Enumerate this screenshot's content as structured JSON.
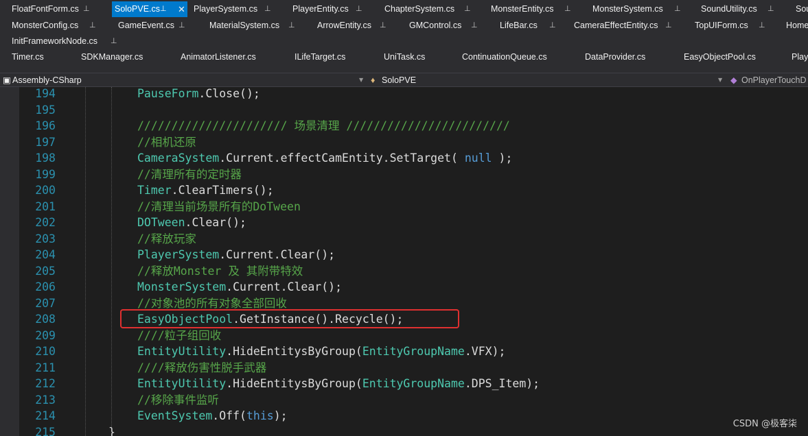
{
  "tabs": {
    "row1": [
      {
        "label": "FloatFontForm.cs"
      },
      {
        "label": "SoloPVE.cs",
        "active": true
      },
      {
        "label": "PlayerSystem.cs"
      },
      {
        "label": "PlayerEntity.cs"
      },
      {
        "label": "ChapterSystem.cs"
      },
      {
        "label": "MonsterEntity.cs"
      },
      {
        "label": "MonsterSystem.cs"
      },
      {
        "label": "SoundUtility.cs"
      },
      {
        "label": "Sou"
      }
    ],
    "row2": [
      {
        "label": "MonsterConfig.cs"
      },
      {
        "label": "GameEvent.cs"
      },
      {
        "label": "MaterialSystem.cs"
      },
      {
        "label": "ArrowEntity.cs"
      },
      {
        "label": "GMControl.cs"
      },
      {
        "label": "LifeBar.cs"
      },
      {
        "label": "CameraEffectEntity.cs"
      },
      {
        "label": "TopUIForm.cs"
      },
      {
        "label": "Home"
      }
    ],
    "row3": [
      {
        "label": "InitFrameworkNode.cs"
      }
    ],
    "row4": [
      {
        "label": "Timer.cs"
      },
      {
        "label": "SDKManager.cs"
      },
      {
        "label": "AnimatorListener.cs"
      },
      {
        "label": "ILifeTarget.cs"
      },
      {
        "label": "UniTask.cs"
      },
      {
        "label": "ContinuationQueue.cs"
      },
      {
        "label": "DataProvider.cs"
      },
      {
        "label": "EasyObjectPool.cs"
      },
      {
        "label": "Play"
      }
    ],
    "pin_glyph": "⌙",
    "close_glyph": "✕"
  },
  "navbar": {
    "project": "Assembly-CSharp",
    "class": "SoloPVE",
    "member": "OnPlayerTouchD"
  },
  "code_lines": [
    {
      "num": "194",
      "tokens": [
        {
          "t": "PauseForm",
          "c": "cls"
        },
        {
          "t": ".Close();",
          "c": "mth"
        }
      ]
    },
    {
      "num": "195",
      "tokens": []
    },
    {
      "num": "196",
      "tokens": [
        {
          "t": "////////////////////// 场景清理 ////////////////////////",
          "c": "cmt"
        }
      ]
    },
    {
      "num": "197",
      "tokens": [
        {
          "t": "//相机还原",
          "c": "cmt"
        }
      ]
    },
    {
      "num": "198",
      "tokens": [
        {
          "t": "CameraSystem",
          "c": "cls"
        },
        {
          "t": ".Current.effectCamEntity.SetTarget( ",
          "c": "mth"
        },
        {
          "t": "null",
          "c": "kw"
        },
        {
          "t": " );",
          "c": "mth"
        }
      ]
    },
    {
      "num": "199",
      "tokens": [
        {
          "t": "//清理所有的定时器",
          "c": "cmt"
        }
      ]
    },
    {
      "num": "200",
      "tokens": [
        {
          "t": "Timer",
          "c": "cls"
        },
        {
          "t": ".ClearTimers();",
          "c": "mth"
        }
      ]
    },
    {
      "num": "201",
      "tokens": [
        {
          "t": "//清理当前场景所有的DoTween",
          "c": "cmt"
        }
      ]
    },
    {
      "num": "202",
      "tokens": [
        {
          "t": "DOTween",
          "c": "cls"
        },
        {
          "t": ".Clear();",
          "c": "mth"
        }
      ]
    },
    {
      "num": "203",
      "tokens": [
        {
          "t": "//释放玩家",
          "c": "cmt"
        }
      ]
    },
    {
      "num": "204",
      "tokens": [
        {
          "t": "PlayerSystem",
          "c": "cls"
        },
        {
          "t": ".Current.Clear();",
          "c": "mth"
        }
      ]
    },
    {
      "num": "205",
      "tokens": [
        {
          "t": "//释放Monster 及 其附带特效",
          "c": "cmt"
        }
      ]
    },
    {
      "num": "206",
      "tokens": [
        {
          "t": "MonsterSystem",
          "c": "cls"
        },
        {
          "t": ".Current.Clear();",
          "c": "mth"
        }
      ]
    },
    {
      "num": "207",
      "tokens": [
        {
          "t": "//对象池的所有对象全部回收",
          "c": "cmt"
        }
      ]
    },
    {
      "num": "208",
      "tokens": [
        {
          "t": "EasyObjectPool",
          "c": "cls"
        },
        {
          "t": ".GetInstance().Recycle();",
          "c": "mth"
        }
      ]
    },
    {
      "num": "209",
      "tokens": [
        {
          "t": "////粒子组回收",
          "c": "cmt"
        }
      ]
    },
    {
      "num": "210",
      "tokens": [
        {
          "t": "EntityUtility",
          "c": "cls"
        },
        {
          "t": ".HideEntitysByGroup(",
          "c": "mth"
        },
        {
          "t": "EntityGroupName",
          "c": "cls"
        },
        {
          "t": ".VFX);",
          "c": "mth"
        }
      ]
    },
    {
      "num": "211",
      "tokens": [
        {
          "t": "////释放伤害性脱手武器",
          "c": "cmt"
        }
      ]
    },
    {
      "num": "212",
      "tokens": [
        {
          "t": "EntityUtility",
          "c": "cls"
        },
        {
          "t": ".HideEntitysByGroup(",
          "c": "mth"
        },
        {
          "t": "EntityGroupName",
          "c": "cls"
        },
        {
          "t": ".DPS_Item);",
          "c": "mth"
        }
      ]
    },
    {
      "num": "213",
      "tokens": [
        {
          "t": "//移除事件监听",
          "c": "cmt"
        }
      ]
    },
    {
      "num": "214",
      "tokens": [
        {
          "t": "EventSystem",
          "c": "cls"
        },
        {
          "t": ".Off(",
          "c": "mth"
        },
        {
          "t": "this",
          "c": "kw"
        },
        {
          "t": ");",
          "c": "mth"
        }
      ]
    },
    {
      "num": "215",
      "tokens": [
        {
          "t": "}",
          "c": "mth"
        }
      ]
    }
  ],
  "highlighted_line": "208",
  "watermark": "CSDN @极客柒"
}
